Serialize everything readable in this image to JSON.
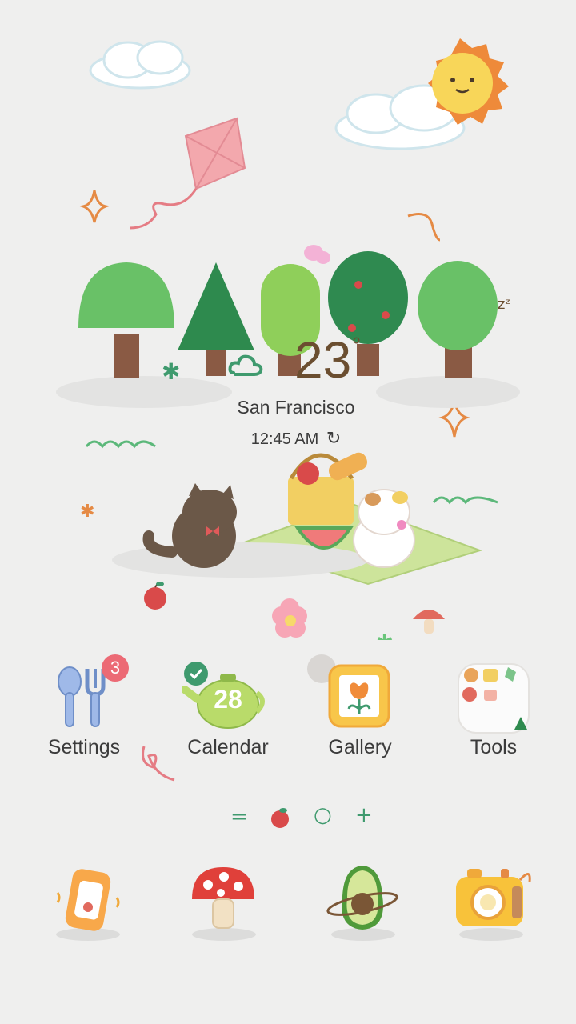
{
  "weather": {
    "temperature": "23",
    "degree_symbol": "°",
    "city": "San Francisco",
    "time": "12:45 AM",
    "condition_icon": "cloud-icon",
    "refresh_icon": "refresh-icon"
  },
  "apps": [
    {
      "label": "Settings",
      "icon": "spoon-fork-icon",
      "badge": "3"
    },
    {
      "label": "Calendar",
      "icon": "kettle-calendar-icon",
      "date": "28"
    },
    {
      "label": "Gallery",
      "icon": "flower-frame-icon"
    },
    {
      "label": "Tools",
      "icon": "folder-icon"
    }
  ],
  "page_indicator": {
    "items": [
      "=",
      "apple",
      "○",
      "+"
    ],
    "active_index": 1
  },
  "dock": [
    {
      "name": "phone",
      "icon": "phone-icon"
    },
    {
      "name": "mushroom",
      "icon": "mushroom-icon"
    },
    {
      "name": "avocado",
      "icon": "avocado-planet-icon"
    },
    {
      "name": "camera",
      "icon": "camera-icon"
    }
  ],
  "colors": {
    "background": "#efefee",
    "badge": "#ec6a75",
    "accent_green": "#3f9a6e",
    "text": "#3b3b3b"
  }
}
